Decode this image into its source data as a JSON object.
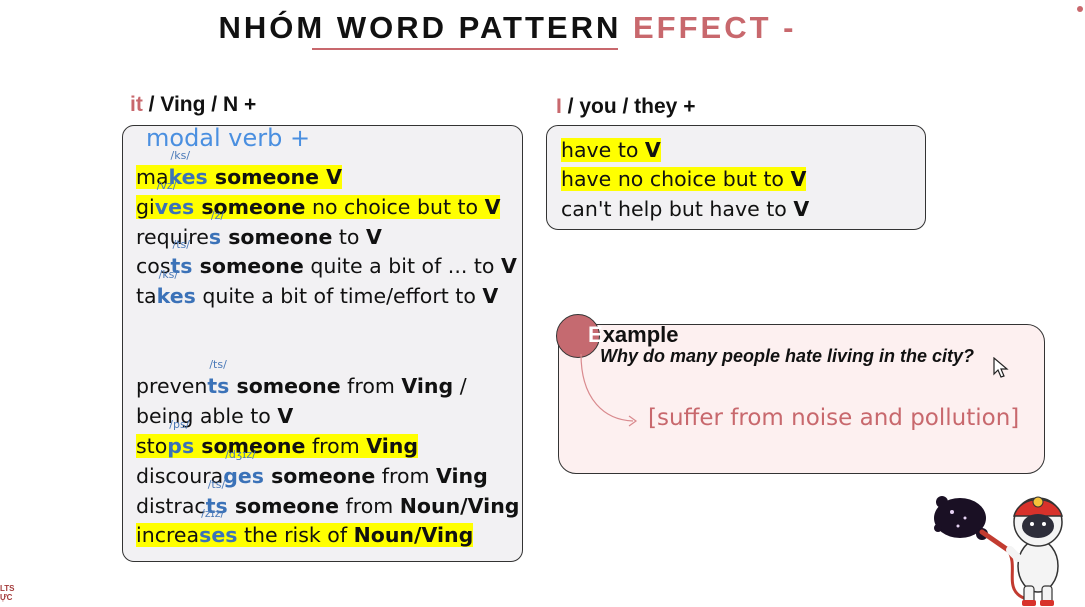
{
  "title": {
    "main": "NHÓM WORD PATTERN",
    "accent": "EFFECT -"
  },
  "left_heading": {
    "accent": "it",
    "rest": " / Ving / N +"
  },
  "right_heading": {
    "accent": "I",
    "rest": " / you / they +"
  },
  "modal_label": "modal verb +",
  "left_lines": {
    "l1": {
      "pre": "ma",
      "suf": "kes",
      "ipa": "/ks/",
      "b1": " someone V"
    },
    "l2": {
      "pre": "gi",
      "suf": "ves",
      "ipa": "/vz/",
      "b1": " someone",
      "t1": " no choice but to ",
      "b2": "V"
    },
    "l3": {
      "pre": "require",
      "suf": "s",
      "ipa": "/z/",
      "b1": " someone",
      "t1": " to ",
      "b2": "V"
    },
    "l4": {
      "pre": "cos",
      "suf": "ts",
      "ipa": "/ts/",
      "b1": " someone",
      "t1": " quite a bit of ... to ",
      "b2": "V"
    },
    "l5": {
      "pre": "ta",
      "suf": "kes",
      "ipa": "/ks/",
      "t1": " quite a bit of time/effort to ",
      "b2": "V"
    },
    "l6": {
      "pre": "preven",
      "suf": "ts",
      "ipa": "/ts/",
      "b1": " someone",
      "t1": " from ",
      "b2": "Ving",
      "t2": " /"
    },
    "l7": {
      "t1": "being able to ",
      "b2": "V"
    },
    "l8": {
      "pre": "sto",
      "suf": "ps",
      "ipa": "/ps/",
      "b1": " someone",
      "t1": " from ",
      "b2": "Ving"
    },
    "l9": {
      "pre": "discoura",
      "suf": "ges",
      "ipa": "/dʒɪz/",
      "b1": " someone",
      "t1": " from ",
      "b2": "Ving"
    },
    "l10": {
      "pre": "distrac",
      "suf": "ts",
      "ipa": "/ts/",
      "b1": " someone",
      "t1": " from ",
      "b2": "Noun/Ving"
    },
    "l11": {
      "pre": "increa",
      "suf": "ses",
      "ipa": "/zɪz/",
      "t1": " the risk of ",
      "b2": "Noun/Ving"
    }
  },
  "right_lines": {
    "r1": {
      "t": "have to ",
      "b": "V"
    },
    "r2": {
      "t": "have no choice but to ",
      "b": "V"
    },
    "r3": {
      "t": "can't help but have to ",
      "b": "V"
    }
  },
  "example": {
    "first_letter": "E",
    "rest": "xample",
    "question": "Why do many people hate living in the city?",
    "answer": "[suffer from noise and pollution]"
  },
  "colors": {
    "accent": "#c8686d",
    "highlight": "#ffff00",
    "suffix": "#3b72b8",
    "modal": "#4a8fe0"
  },
  "icons": [
    "cursor-icon",
    "astronaut-mascot-icon",
    "logo-icon"
  ]
}
